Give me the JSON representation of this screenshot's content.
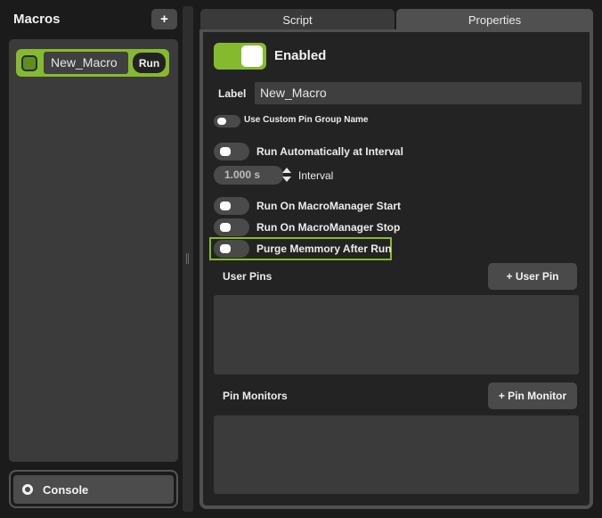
{
  "sidebar": {
    "title": "Macros",
    "add_label": "+",
    "macros": [
      {
        "name": "New_Macro",
        "run_label": "Run"
      }
    ],
    "console_label": "Console"
  },
  "tabs": [
    {
      "label": "Script",
      "active": false
    },
    {
      "label": "Properties",
      "active": true
    }
  ],
  "properties": {
    "enabled_label": "Enabled",
    "enabled": true,
    "label_field": {
      "label": "Label",
      "value": "New_Macro"
    },
    "custom_pin_group": {
      "label": "Use Custom Pin Group Name",
      "on": false
    },
    "run_at_interval": {
      "label": "Run Automatically at Interval",
      "on": false
    },
    "interval": {
      "value": "1.000 s",
      "label": "Interval"
    },
    "run_on_start": {
      "label": "Run On MacroManager Start",
      "on": false
    },
    "run_on_stop": {
      "label": "Run On MacroManager Stop",
      "on": false
    },
    "purge_memory": {
      "label": "Purge Memmory After Run",
      "on": false
    },
    "user_pins": {
      "label": "User Pins",
      "button": "+ User Pin"
    },
    "pin_monitors": {
      "label": "Pin Monitors",
      "button": "+ Pin Monitor"
    }
  },
  "colors": {
    "accent": "#86ba2e",
    "panel": "#3b3b3b",
    "background": "#1b1b1b"
  }
}
